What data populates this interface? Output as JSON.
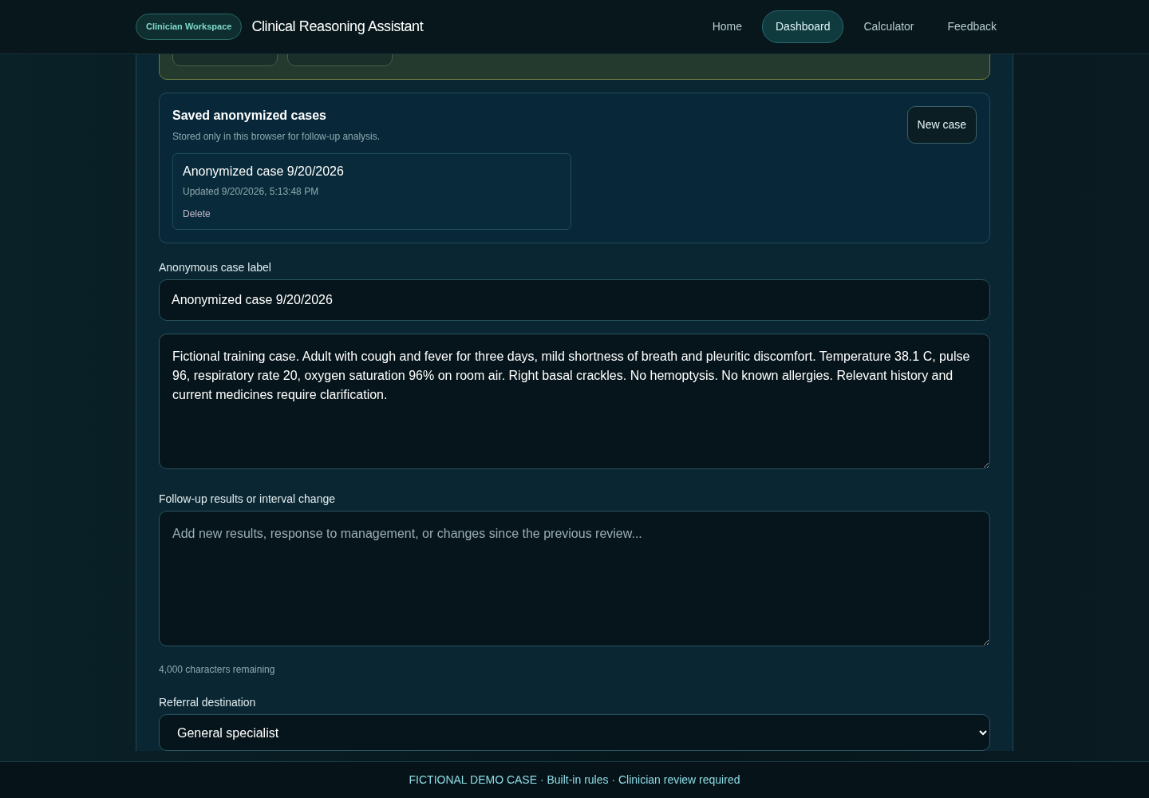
{
  "header": {
    "badge": "Clinician Workspace",
    "title": "Clinical Reasoning Assistant",
    "nav": [
      {
        "label": "Home",
        "selected": false
      },
      {
        "label": "Dashboard",
        "selected": true
      },
      {
        "label": "Calculator",
        "selected": false
      },
      {
        "label": "Feedback",
        "selected": false
      }
    ]
  },
  "saved_cases": {
    "title": "Saved anonymized cases",
    "subtitle": "Stored only in this browser for follow-up analysis.",
    "new_case_button": "New case",
    "cases": [
      {
        "title": "Anonymized case 9/20/2026",
        "updated": "Updated 9/20/2026, 5:13:48 PM",
        "delete": "Delete"
      }
    ]
  },
  "case_label": {
    "label": "Anonymous case label",
    "value": "Anonymized case 9/20/2026"
  },
  "case_notes": {
    "value": "Fictional training case. Adult with cough and fever for three days, mild shortness of breath and pleuritic discomfort. Temperature 38.1 C, pulse 96, respiratory rate 20, oxygen saturation 96% on room air. Right basal crackles. No hemoptysis. No known allergies. Relevant history and current medicines require clarification."
  },
  "follow_up": {
    "label": "Follow-up results or interval change",
    "placeholder": "Add new results, response to management, or changes since the previous review...",
    "remaining": "4,000 characters remaining"
  },
  "referral": {
    "label": "Referral destination",
    "value": "General specialist"
  },
  "footer": {
    "text": "FICTIONAL DEMO CASE · Built-in rules · Clinician review required"
  }
}
